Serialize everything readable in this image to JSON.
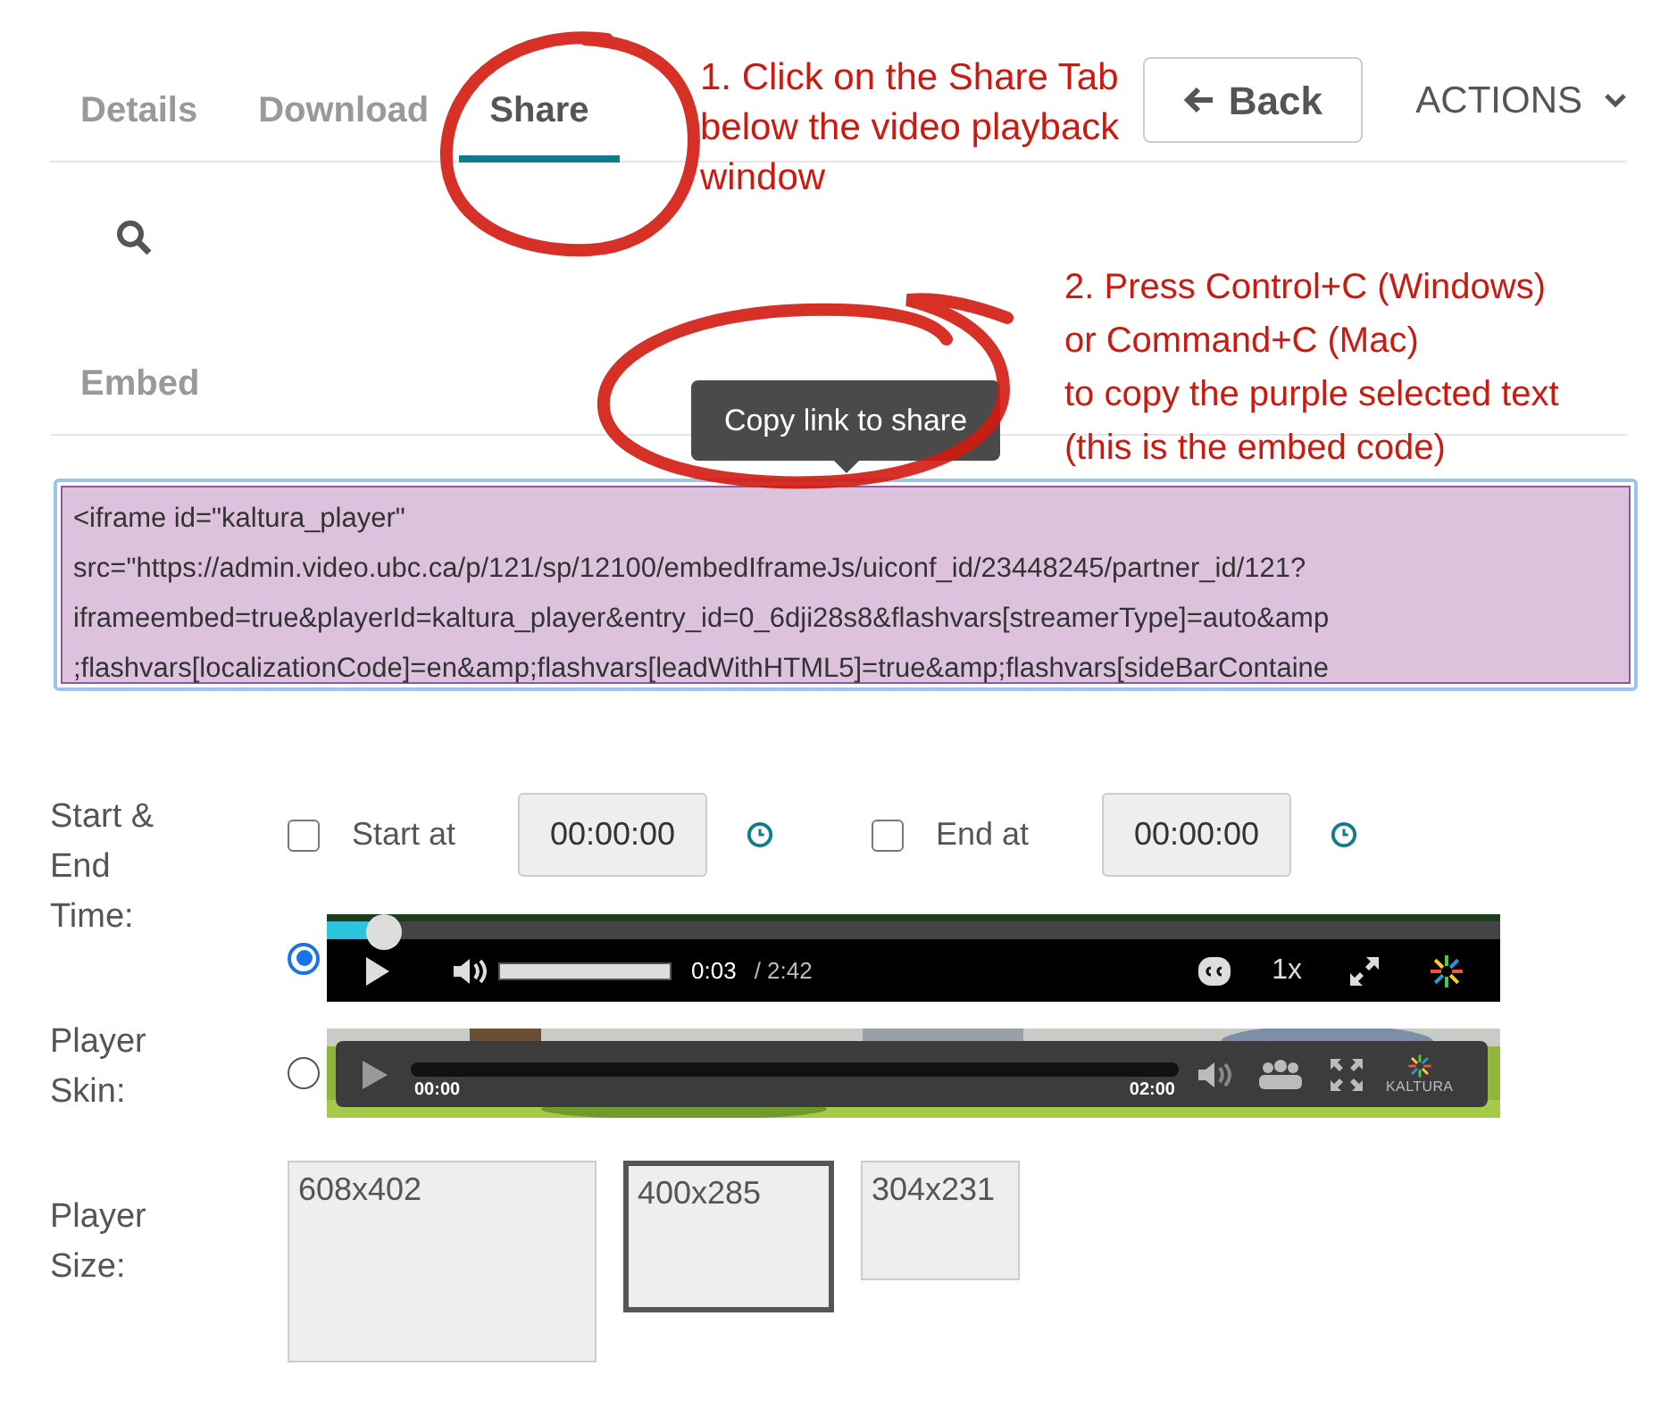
{
  "tabs": [
    {
      "label": "Details",
      "selected": false
    },
    {
      "label": "Download",
      "selected": false
    },
    {
      "label": "Share",
      "selected": true
    }
  ],
  "back_button": {
    "label": "Back"
  },
  "actions_menu": {
    "label": "ACTIONS"
  },
  "embed": {
    "label": "Embed",
    "tooltip": "Copy link to share",
    "code_selected": true,
    "code_lines": [
      "<iframe id=\"kaltura_player\" ",
      "src=\"https://admin.video.ubc.ca/p/121/sp/12100/embedIframeJs/uiconf_id/23448245/partner_id/121?",
      "iframeembed=true&playerId=kaltura_player&entry_id=0_6dji28s8&flashvars[streamerType]=auto&amp",
      ";flashvars[localizationCode]=en&amp;flashvars[leadWithHTML5]=true&amp;flashvars[sideBarContaine"
    ]
  },
  "time": {
    "label": "Start & End Time:",
    "fields": [
      {
        "label": "Start at",
        "checked": false,
        "value": "00:00:00"
      },
      {
        "label": "End at",
        "checked": false,
        "value": "00:00:00"
      }
    ]
  },
  "player_skin": {
    "label": "Player Skin:",
    "options": [
      {
        "kind": "dark-bar",
        "selected": true,
        "progress": {
          "level": 0.04
        },
        "volume": {
          "level": 1
        },
        "elapsed": "0:03",
        "duration": "/ 2:42",
        "speed": "1x"
      },
      {
        "kind": "overlay",
        "selected": false,
        "start": "00:00",
        "end": "02:00",
        "brand": "KALTURA"
      }
    ]
  },
  "player_size": {
    "label": "Player Size:",
    "options": [
      {
        "label": "608x402",
        "selected": false
      },
      {
        "label": "400x285",
        "selected": true
      },
      {
        "label": "304x231",
        "selected": false
      }
    ]
  },
  "annotations": [
    {
      "lines": [
        "1. Click on the Share Tab",
        "below the video playback",
        "window"
      ]
    },
    {
      "lines": [
        "2. Press Control+C (Windows)",
        "or Command+C (Mac)",
        "to copy the purple selected text",
        "(this is the embed code)"
      ]
    }
  ]
}
